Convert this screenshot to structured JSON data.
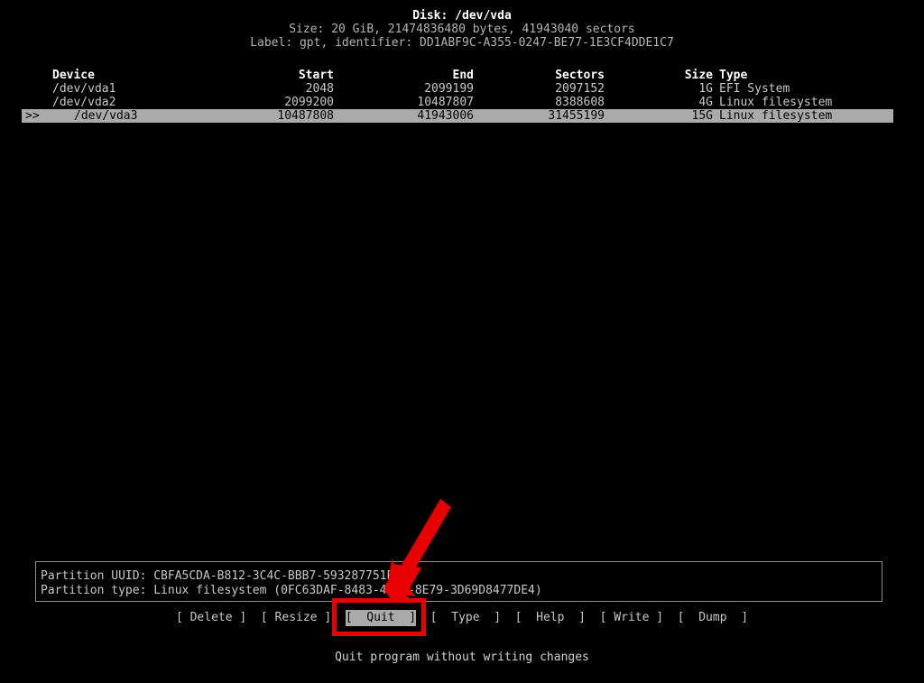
{
  "header": {
    "disk_title": "Disk: /dev/vda",
    "size_line": "Size: 20 GiB, 21474836480 bytes, 41943040 sectors",
    "label_line": "Label: gpt, identifier: DD1ABF9C-A355-0247-BE77-1E3CF4DDE1C7"
  },
  "table": {
    "columns": [
      "Device",
      "Start",
      "End",
      "Sectors",
      "Size",
      "Type"
    ],
    "header": {
      "marker": "",
      "device": "Device",
      "start": "Start",
      "end": "End",
      "sectors": "Sectors",
      "size": "Size",
      "type": "Type"
    },
    "rows": [
      {
        "marker": "",
        "device": "/dev/vda1",
        "start": "2048",
        "end": "2099199",
        "sectors": "2097152",
        "size": "1G",
        "type": "EFI System",
        "selected": false
      },
      {
        "marker": "",
        "device": "/dev/vda2",
        "start": "2099200",
        "end": "10487807",
        "sectors": "8388608",
        "size": "4G",
        "type": "Linux filesystem",
        "selected": false
      },
      {
        "marker": ">>",
        "device": "/dev/vda3",
        "start": "10487808",
        "end": "41943006",
        "sectors": "31455199",
        "size": "15G",
        "type": "Linux filesystem",
        "selected": true
      }
    ]
  },
  "info": {
    "uuid_line": "Partition UUID: CBFA5CDA-B812-3C4C-BBB7-593287751EF0",
    "type_line": "Partition type: Linux filesystem (0FC63DAF-8483-4772-8E79-3D69D8477DE4)"
  },
  "menu": {
    "buttons": [
      {
        "label": "[ Delete ]",
        "selected": false
      },
      {
        "label": "[ Resize ]",
        "selected": false
      },
      {
        "label": "[  Quit  ]",
        "selected": true
      },
      {
        "label": "[  Type  ]",
        "selected": false
      },
      {
        "label": "[  Help  ]",
        "selected": false
      },
      {
        "label": "[ Write ]",
        "selected": false
      },
      {
        "label": "[  Dump  ]",
        "selected": false
      }
    ],
    "separator": "  "
  },
  "hint": "Quit program without writing changes",
  "annotations": {
    "highlight_color": "#e60000",
    "arrow_color": "#e60000",
    "target_button": "[  Quit  ]"
  },
  "colors": {
    "background": "#000000",
    "foreground": "#c8c8c8",
    "selection_background": "#aaaaaa",
    "selection_foreground": "#000000",
    "box_border": "#8f8f8f"
  }
}
